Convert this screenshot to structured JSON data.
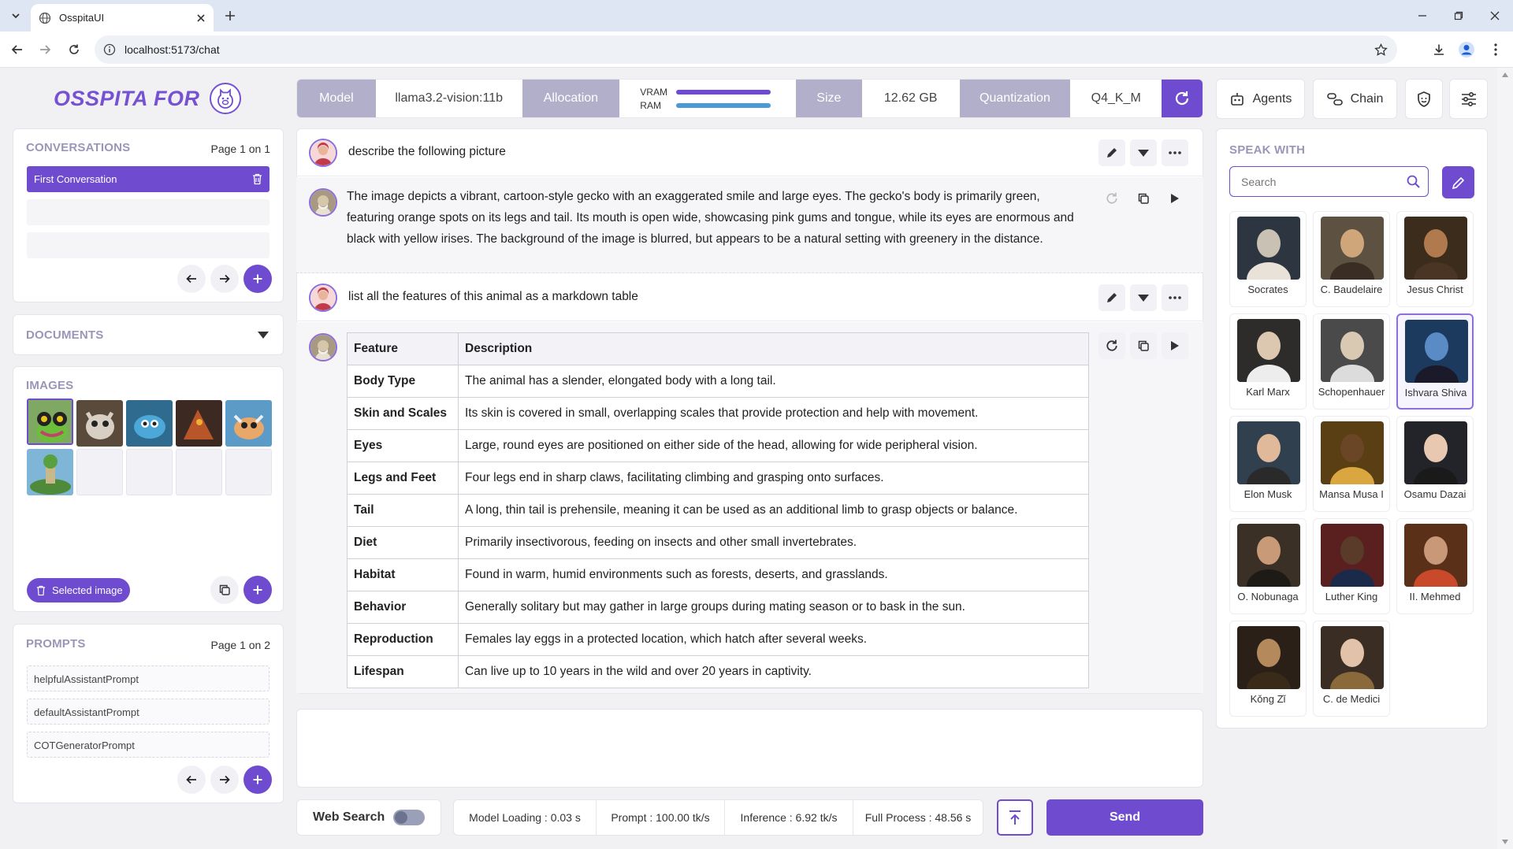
{
  "browser": {
    "tab_title": "OsspitaUI",
    "url": "localhost:5173/chat"
  },
  "logo": {
    "text": "OSSPITA FOR"
  },
  "header": {
    "model_label": "Model",
    "model_value": "llama3.2-vision:11b",
    "allocation_label": "Allocation",
    "vram_label": "VRAM",
    "ram_label": "RAM",
    "vram_fill": 1.0,
    "ram_fill": 1.0,
    "size_label": "Size",
    "size_value": "12.62 GB",
    "quant_label": "Quantization",
    "quant_value": "Q4_K_M"
  },
  "conversations": {
    "title": "CONVERSATIONS",
    "page": "Page 1 on 1",
    "items": [
      "First Conversation"
    ]
  },
  "documents": {
    "title": "DOCUMENTS"
  },
  "images": {
    "title": "IMAGES",
    "selected_label": "Selected image"
  },
  "prompts": {
    "title": "PROMPTS",
    "page": "Page 1 on 2",
    "items": [
      "helpfulAssistantPrompt",
      "defaultAssistantPrompt",
      "COTGeneratorPrompt"
    ]
  },
  "chat": {
    "q1": "describe the following picture",
    "a1": "The image depicts a vibrant, cartoon-style gecko with an exaggerated smile and large eyes. The gecko's body is primarily green, featuring orange spots on its legs and tail. Its mouth is open wide, showcasing pink gums and tongue, while its eyes are enormous and black with yellow irises. The background of the image is blurred, but appears to be a natural setting with greenery in the distance.",
    "q2": "list all the features of this animal as a markdown table",
    "table": {
      "headers": [
        "Feature",
        "Description"
      ],
      "rows": [
        [
          "Body Type",
          "The animal has a slender, elongated body with a long tail."
        ],
        [
          "Skin and Scales",
          "Its skin is covered in small, overlapping scales that provide protection and help with movement."
        ],
        [
          "Eyes",
          "Large, round eyes are positioned on either side of the head, allowing for wide peripheral vision."
        ],
        [
          "Legs and Feet",
          "Four legs end in sharp claws, facilitating climbing and grasping onto surfaces."
        ],
        [
          "Tail",
          "A long, thin tail is prehensile, meaning it can be used as an additional limb to grasp objects or balance."
        ],
        [
          "Diet",
          "Primarily insectivorous, feeding on insects and other small invertebrates."
        ],
        [
          "Habitat",
          "Found in warm, humid environments such as forests, deserts, and grasslands."
        ],
        [
          "Behavior",
          "Generally solitary but may gather in large groups during mating season or to bask in the sun."
        ],
        [
          "Reproduction",
          "Females lay eggs in a protected location, which hatch after several weeks."
        ],
        [
          "Lifespan",
          "Can live up to 10 years in the wild and over 20 years in captivity."
        ]
      ]
    }
  },
  "footer": {
    "web_search_label": "Web Search",
    "web_search_on": false,
    "model_loading": "Model Loading : 0.03 s",
    "prompt_speed": "Prompt : 100.00 tk/s",
    "inference_speed": "Inference : 6.92 tk/s",
    "full_process": "Full Process : 48.56 s",
    "send_label": "Send"
  },
  "right": {
    "agents_label": "Agents",
    "chain_label": "Chain",
    "speak_with_title": "SPEAK WITH",
    "search_placeholder": "Search",
    "selected_persona": "Ishvara Shiva",
    "personas": [
      "Socrates",
      "C. Baudelaire",
      "Jesus Christ",
      "Karl Marx",
      "Schopenhauer",
      "Ishvara Shiva",
      "Elon Musk",
      "Mansa Musa I",
      "Osamu Dazai",
      "O. Nobunaga",
      "Luther King",
      "II. Mehmed",
      "Kǒng Zǐ",
      "C. de Medici"
    ]
  },
  "colors": {
    "accent": "#6f4bd0",
    "header_label_bg": "#b1afca",
    "section_title": "#9b96b8"
  }
}
